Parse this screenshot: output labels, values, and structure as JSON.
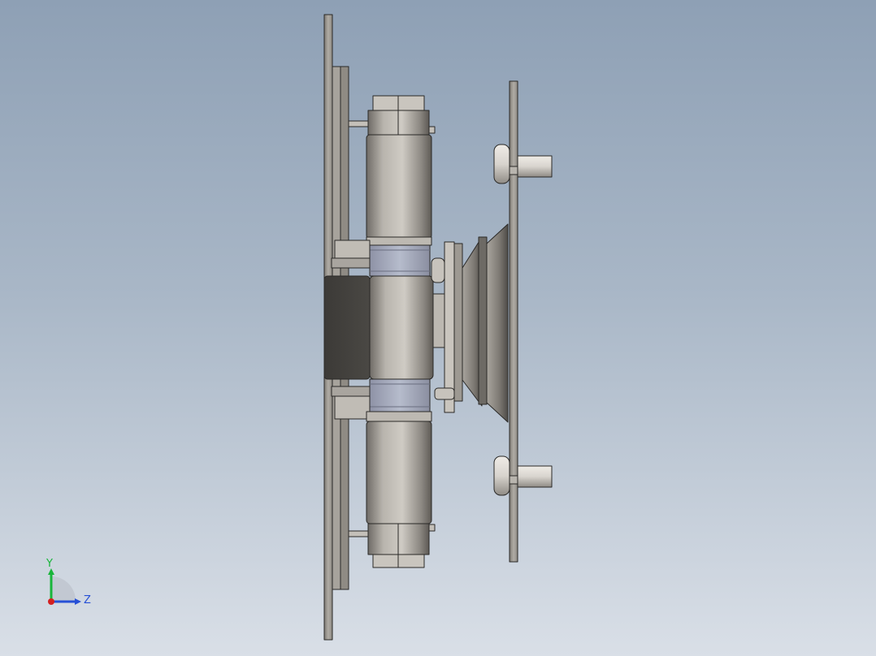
{
  "view": {
    "background_top": "#8ea0b5",
    "background_bottom": "#d9dfe7"
  },
  "model": {
    "parts": [
      "mounting-plate",
      "cylinder-upper",
      "cylinder-lower",
      "center-block",
      "hex-nut-top",
      "hex-nut-bottom",
      "guide-rod",
      "bracket",
      "suction-cup",
      "suction-plate",
      "stud-upper",
      "stud-lower"
    ]
  },
  "triad": {
    "y_label": "Y",
    "z_label": "Z",
    "y_color": "#18b53a",
    "z_color": "#2650d6",
    "origin_color": "#d42020"
  }
}
